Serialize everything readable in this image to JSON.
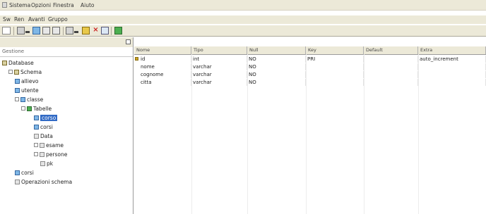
{
  "menubar": {
    "items": [
      "Sistema",
      "Opzioni",
      "Finestra",
      "Aiuto"
    ],
    "sub_items": [
      "Sw",
      "Ren",
      "Avanti",
      "Gruppo"
    ]
  },
  "left_pane": {
    "header": "Gestione",
    "tree": [
      {
        "label": "Database",
        "depth": 0,
        "icon": "database-icon",
        "expander": false,
        "selected": false
      },
      {
        "label": "Schema",
        "depth": 1,
        "icon": "schema-icon",
        "expander": true,
        "selected": false
      },
      {
        "label": "allievo",
        "depth": 2,
        "icon": "table-icon",
        "expander": false,
        "selected": false
      },
      {
        "label": "utente",
        "depth": 2,
        "icon": "table-icon",
        "expander": false,
        "selected": false
      },
      {
        "label": "classe",
        "depth": 2,
        "icon": "table-icon",
        "expander": true,
        "selected": false
      },
      {
        "label": "Tabelle",
        "depth": 3,
        "icon": "folder-icon",
        "expander": true,
        "selected": false
      },
      {
        "label": "corso",
        "depth": 5,
        "icon": "table-icon",
        "expander": false,
        "selected": true
      },
      {
        "label": "corsi",
        "depth": 5,
        "icon": "table-icon",
        "expander": false,
        "selected": false
      },
      {
        "label": "Data",
        "depth": 5,
        "icon": "field-icon",
        "expander": false,
        "selected": false
      },
      {
        "label": "esame",
        "depth": 5,
        "icon": "field-icon",
        "expander": true,
        "selected": false
      },
      {
        "label": "persone",
        "depth": 5,
        "icon": "field-icon",
        "expander": true,
        "selected": false
      },
      {
        "label": "pk",
        "depth": 6,
        "icon": "key-icon",
        "expander": false,
        "selected": false
      },
      {
        "label": "corsi",
        "depth": 2,
        "icon": "table-icon",
        "expander": false,
        "selected": false
      },
      {
        "label": "Operazioni schema",
        "depth": 2,
        "icon": "gear-icon",
        "expander": false,
        "selected": false
      }
    ]
  },
  "grid": {
    "columns": [
      "Nome",
      "Tipo",
      "Null",
      "Key",
      "Default",
      "Extra"
    ],
    "rows": [
      {
        "marker": true,
        "cells": [
          "id",
          "int",
          "NO",
          "PRI",
          "",
          "auto_increment"
        ]
      },
      {
        "marker": false,
        "cells": [
          "nome",
          "varchar",
          "NO",
          "",
          "",
          ""
        ]
      },
      {
        "marker": false,
        "cells": [
          "cognome",
          "varchar",
          "NO",
          "",
          "",
          ""
        ]
      },
      {
        "marker": false,
        "cells": [
          "citta",
          "varchar",
          "NO",
          "",
          "",
          ""
        ]
      }
    ]
  },
  "colors": {
    "chrome": "#ece9d8",
    "selection": "#316ac5",
    "separator": "#aca899"
  }
}
